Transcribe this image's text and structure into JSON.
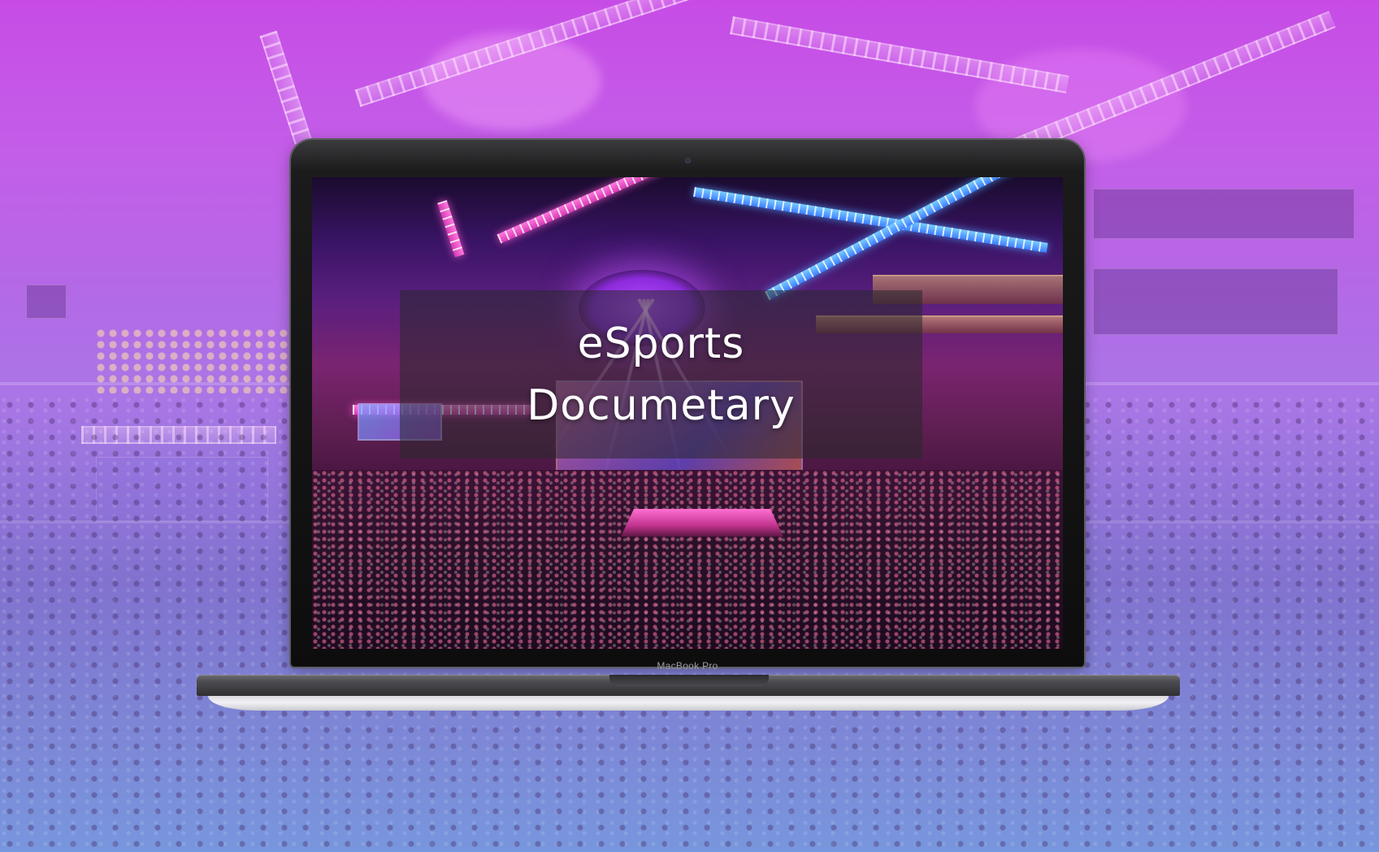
{
  "screen_title": {
    "line1": "eSports",
    "line2": "Documetary"
  },
  "laptop": {
    "brand_label": "MacBook Pro"
  },
  "colors": {
    "background_top": "#c74ce6",
    "background_bottom": "#82a4e4",
    "overlay": "#28282c",
    "title_text": "#ffffff"
  },
  "icons": {
    "camera": "camera-icon"
  }
}
